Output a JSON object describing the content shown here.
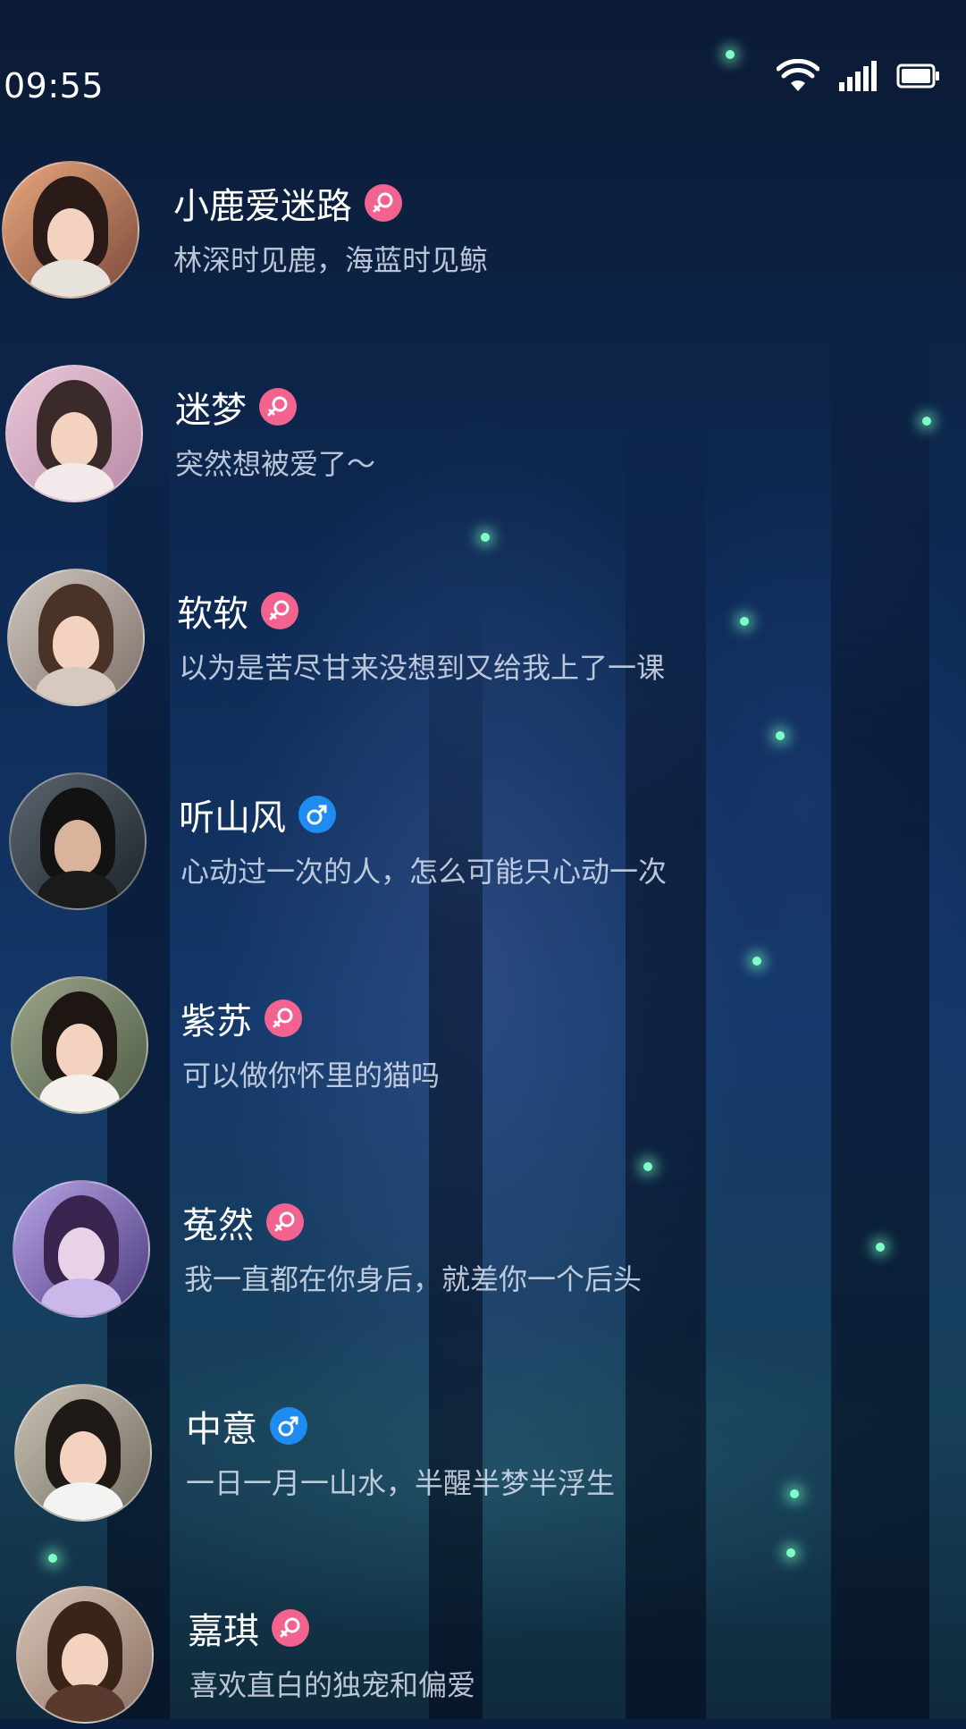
{
  "status_bar": {
    "time": "09:55",
    "icons": [
      "wifi-icon",
      "signal-icon",
      "battery-icon"
    ]
  },
  "contacts": [
    {
      "name": "小鹿爱迷路",
      "gender": "female",
      "signature": "林深时见鹿，海蓝时见鲸"
    },
    {
      "name": "迷梦",
      "gender": "female",
      "signature": "突然想被爱了～"
    },
    {
      "name": "软软",
      "gender": "female",
      "signature": "以为是苦尽甘来没想到又给我上了一课"
    },
    {
      "name": "听山风",
      "gender": "male",
      "signature": "心动过一次的人，怎么可能只心动一次"
    },
    {
      "name": "紫苏",
      "gender": "female",
      "signature": "可以做你怀里的猫吗"
    },
    {
      "name": "菟然",
      "gender": "female",
      "signature": "我一直都在你身后，就差你一个后头"
    },
    {
      "name": "中意",
      "gender": "male",
      "signature": "一日一月一山水，半醒半梦半浮生"
    },
    {
      "name": "嘉琪",
      "gender": "female",
      "signature": "喜欢直白的独宠和偏爱"
    }
  ],
  "colors": {
    "female_badge": "#f2638f",
    "male_badge": "#1e8cf0",
    "background": "#0e2a55"
  }
}
